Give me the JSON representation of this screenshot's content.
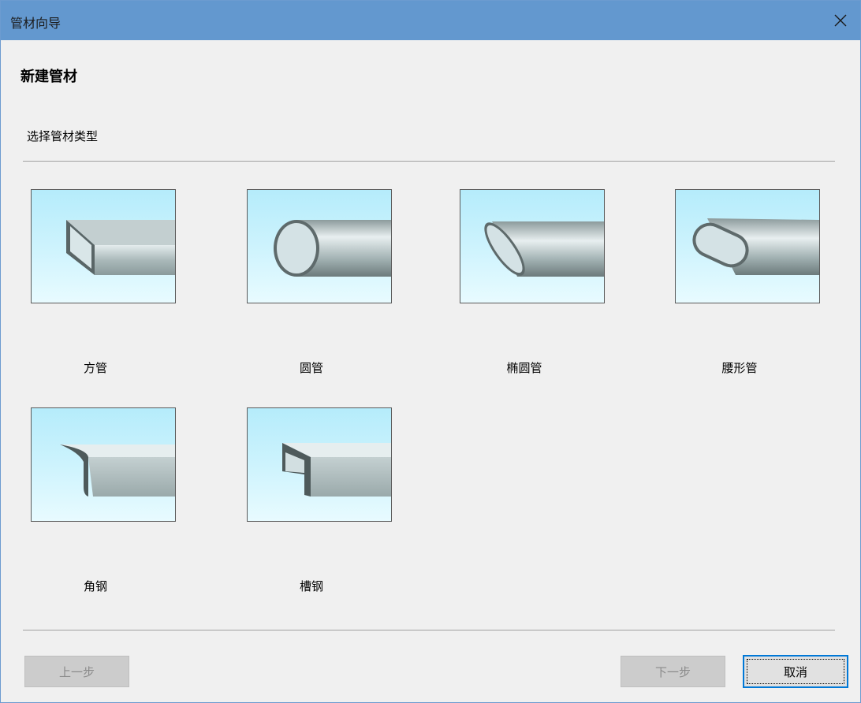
{
  "window": {
    "title": "管材向导"
  },
  "page": {
    "heading": "新建管材",
    "subheading": "选择管材类型"
  },
  "pipe_types": [
    {
      "label": "方管",
      "icon": "square-tube-icon"
    },
    {
      "label": "圆管",
      "icon": "round-tube-icon"
    },
    {
      "label": "椭圆管",
      "icon": "elliptical-tube-icon"
    },
    {
      "label": "腰形管",
      "icon": "obround-tube-icon"
    },
    {
      "label": "角钢",
      "icon": "angle-steel-icon"
    },
    {
      "label": "槽钢",
      "icon": "channel-steel-icon"
    }
  ],
  "buttons": {
    "prev": "上一步",
    "next": "下一步",
    "cancel": "取消"
  },
  "colors": {
    "titlebar": "#6398cf",
    "thumb_bg": "#c7f0fc",
    "accent": "#0078d7"
  }
}
